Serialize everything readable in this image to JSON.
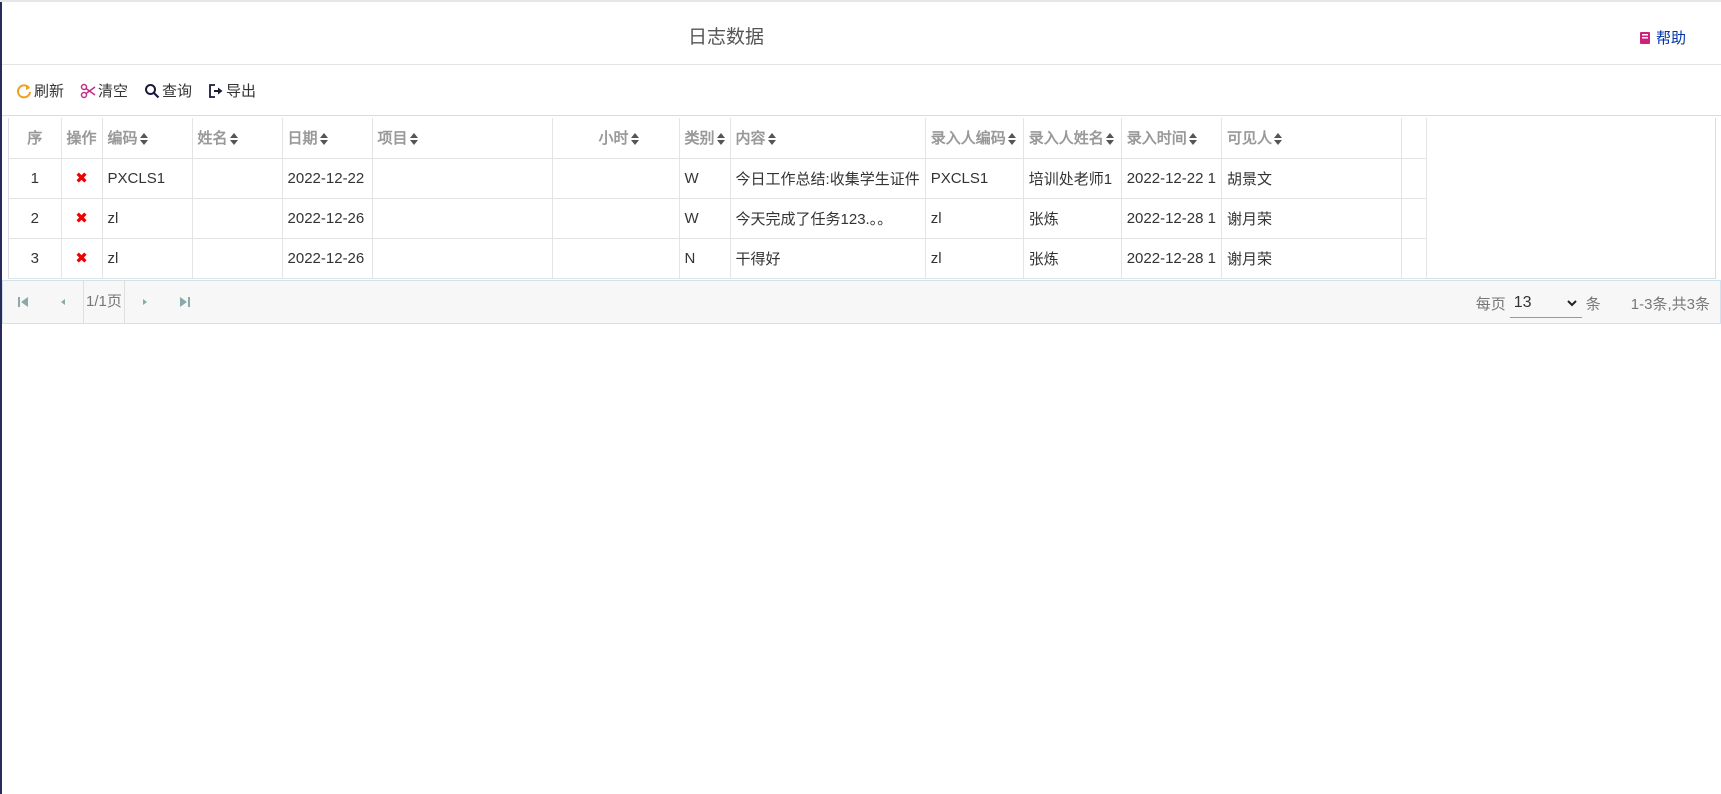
{
  "header": {
    "title": "日志数据",
    "help_label": "帮助"
  },
  "toolbar": {
    "refresh": "刷新",
    "clear": "清空",
    "query": "查询",
    "export": "导出"
  },
  "table": {
    "columns": [
      "序",
      "操作",
      "编码",
      "姓名",
      "日期",
      "项目",
      "小时",
      "类别",
      "内容",
      "录入人编码",
      "录入人姓名",
      "录入时间",
      "可见人"
    ],
    "rows": [
      {
        "seq": "1",
        "code": "PXCLS1",
        "name": "",
        "date": "2022-12-22",
        "project": "",
        "hours": "",
        "category": "W",
        "content": "今日工作总结:收集学生证件",
        "entry_code": "PXCLS1",
        "entry_name": "培训处老师1",
        "entry_time": "2022-12-22 1",
        "visible": "胡景文"
      },
      {
        "seq": "2",
        "code": "zl",
        "name": "",
        "date": "2022-12-26",
        "project": "",
        "hours": "",
        "category": "W",
        "content": "今天完成了任务123.。。",
        "entry_code": "zl",
        "entry_name": "张炼",
        "entry_time": "2022-12-28 1",
        "visible": "谢月荣"
      },
      {
        "seq": "3",
        "code": "zl",
        "name": "",
        "date": "2022-12-26",
        "project": "",
        "hours": "",
        "category": "N",
        "content": "干得好",
        "entry_code": "zl",
        "entry_name": "张炼",
        "entry_time": "2022-12-28 1",
        "visible": "谢月荣"
      }
    ],
    "delete_glyph": "✖"
  },
  "pager": {
    "page_info": "1/1页",
    "per_page_label": "每页",
    "per_page_value": "13",
    "per_page_unit": "条",
    "summary": "1-3条,共3条"
  },
  "colors": {
    "accent_orange": "#f0a020",
    "delete_red": "#e00000",
    "help_blue": "#0033aa",
    "clear_magenta": "#c0308a"
  },
  "icons": {
    "refresh": "refresh-icon",
    "clear": "scissors-icon",
    "query": "search-icon",
    "export": "export-icon",
    "help": "book-icon"
  }
}
